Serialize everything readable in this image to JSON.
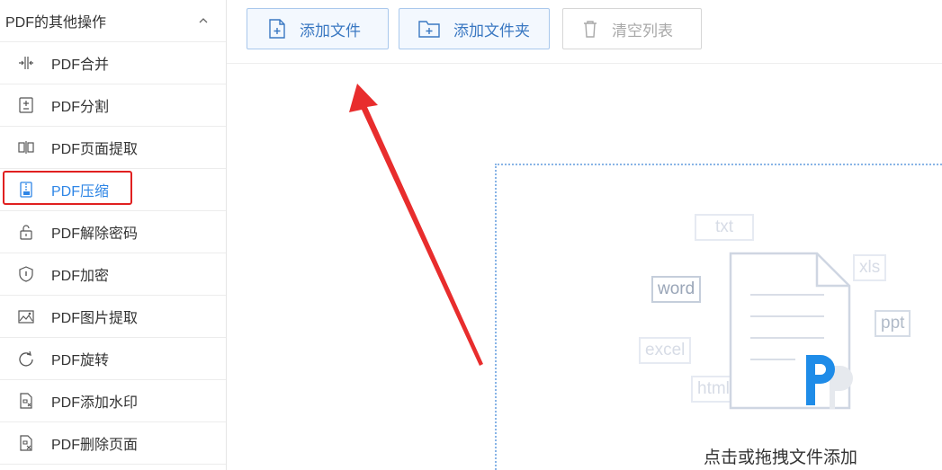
{
  "sidebar": {
    "header": "PDF的其他操作",
    "items": [
      {
        "label": "PDF合并",
        "icon": "merge-icon"
      },
      {
        "label": "PDF分割",
        "icon": "split-icon"
      },
      {
        "label": "PDF页面提取",
        "icon": "page-extract-icon"
      },
      {
        "label": "PDF压缩",
        "icon": "compress-icon"
      },
      {
        "label": "PDF解除密码",
        "icon": "unlock-icon"
      },
      {
        "label": "PDF加密",
        "icon": "shield-icon"
      },
      {
        "label": "PDF图片提取",
        "icon": "image-icon"
      },
      {
        "label": "PDF旋转",
        "icon": "rotate-icon"
      },
      {
        "label": "PDF添加水印",
        "icon": "watermark-icon"
      },
      {
        "label": "PDF删除页面",
        "icon": "delete-page-icon"
      }
    ]
  },
  "toolbar": {
    "add_file": "添加文件",
    "add_folder": "添加文件夹",
    "clear_list": "清空列表"
  },
  "drop": {
    "hint": "点击或拖拽文件添加",
    "tags": [
      "txt",
      "word",
      "xls",
      "ppt",
      "excel",
      "html"
    ]
  },
  "colors": {
    "accent": "#2f86e6",
    "highlight_box": "#e02020",
    "arrow": "#e82d2d"
  }
}
